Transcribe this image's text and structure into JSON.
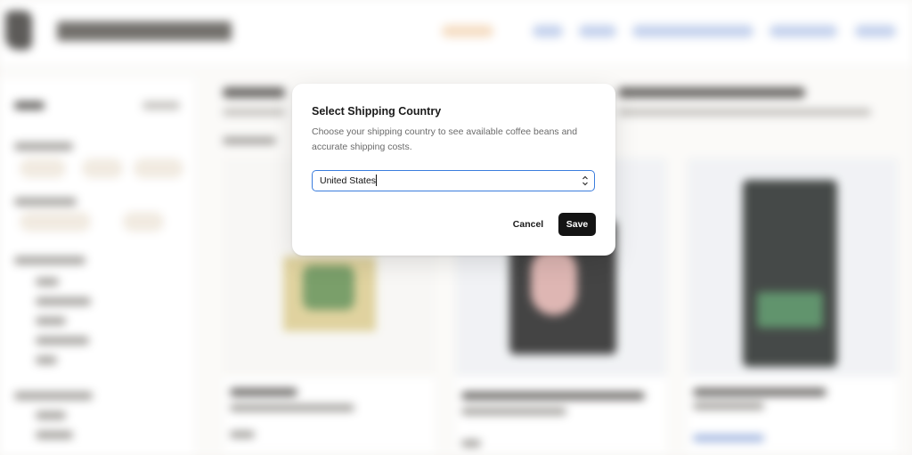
{
  "modal": {
    "title": "Select Shipping Country",
    "description": "Choose your shipping country to see available coffee beans and accurate shipping costs.",
    "country_select": {
      "selected_value": "United States"
    },
    "cancel_label": "Cancel",
    "save_label": "Save"
  },
  "icons": {
    "select_chevron": "chevron-up-down-icon",
    "logo": "logo-icon"
  },
  "colors": {
    "save_button_bg": "#141414",
    "select_focus_border": "#3b7ddd",
    "modal_bg": "#ffffff"
  }
}
